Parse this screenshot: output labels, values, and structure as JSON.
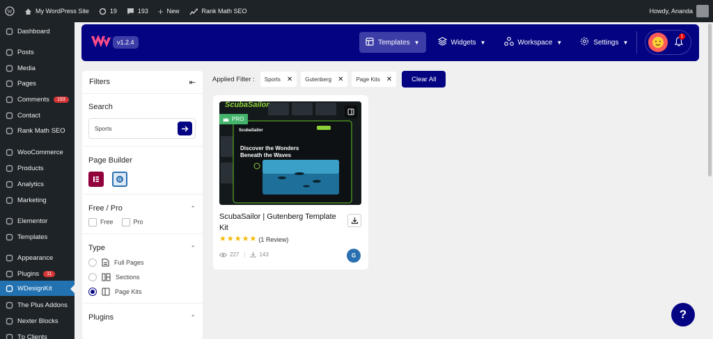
{
  "admin_bar": {
    "site_name": "My WordPress Site",
    "updates_count": "19",
    "comments_count": "193",
    "new_label": "New",
    "rank_math_label": "Rank Math SEO",
    "howdy": "Howdy, Ananda"
  },
  "sidebar": {
    "items": [
      {
        "label": "Dashboard",
        "icon": "dashboard-icon"
      },
      {
        "label": "Posts",
        "icon": "pin-icon"
      },
      {
        "label": "Media",
        "icon": "media-icon"
      },
      {
        "label": "Pages",
        "icon": "page-icon"
      },
      {
        "label": "Comments",
        "icon": "comment-icon",
        "badge": "193"
      },
      {
        "label": "Contact",
        "icon": "mail-icon"
      },
      {
        "label": "Rank Math SEO",
        "icon": "chart-icon"
      },
      {
        "label": "WooCommerce",
        "icon": "woo-icon"
      },
      {
        "label": "Products",
        "icon": "archive-icon"
      },
      {
        "label": "Analytics",
        "icon": "bar-chart-icon"
      },
      {
        "label": "Marketing",
        "icon": "megaphone-icon"
      },
      {
        "label": "Elementor",
        "icon": "elementor-icon"
      },
      {
        "label": "Templates",
        "icon": "folder-icon"
      },
      {
        "label": "Appearance",
        "icon": "brush-icon"
      },
      {
        "label": "Plugins",
        "icon": "plug-icon",
        "badge": "11"
      },
      {
        "label": "WDesignKit",
        "icon": "wdesignkit-icon"
      },
      {
        "label": "The Plus Addons",
        "icon": "plus-addons-icon"
      },
      {
        "label": "Nexter Blocks",
        "icon": "nexter-icon"
      },
      {
        "label": "Tp Clients",
        "icon": "clients-icon"
      }
    ]
  },
  "header": {
    "version": "v1.2.4",
    "nav": [
      {
        "label": "Templates",
        "icon": "templates-icon"
      },
      {
        "label": "Widgets",
        "icon": "widgets-icon"
      },
      {
        "label": "Workspace",
        "icon": "workspace-icon"
      },
      {
        "label": "Settings",
        "icon": "settings-icon"
      }
    ],
    "notification_count": "1"
  },
  "filters": {
    "title": "Filters",
    "search": {
      "title": "Search",
      "value": "Sports"
    },
    "page_builder": {
      "title": "Page Builder"
    },
    "free_pro": {
      "title": "Free / Pro",
      "options": [
        "Free",
        "Pro"
      ]
    },
    "type": {
      "title": "Type",
      "options": [
        "Full Pages",
        "Sections",
        "Page Kits"
      ],
      "selected": "Page Kits"
    },
    "plugins": {
      "title": "Plugins"
    }
  },
  "applied_filter": {
    "label": "Applied Filter :",
    "chips": [
      "Sports",
      "Gutenberg",
      "Page Kits"
    ],
    "clear_label": "Clear All"
  },
  "card": {
    "thumb_brand": "ScubaSailor",
    "thumb_headline_1": "Discover the Wonders",
    "thumb_headline_2": "Beneath the Waves",
    "badge": "PRO",
    "title": "ScubaSailor | Gutenberg Template Kit",
    "rating": 5,
    "review_text": "(1 Review)",
    "views": "227",
    "downloads": "143"
  },
  "help_label": "?"
}
